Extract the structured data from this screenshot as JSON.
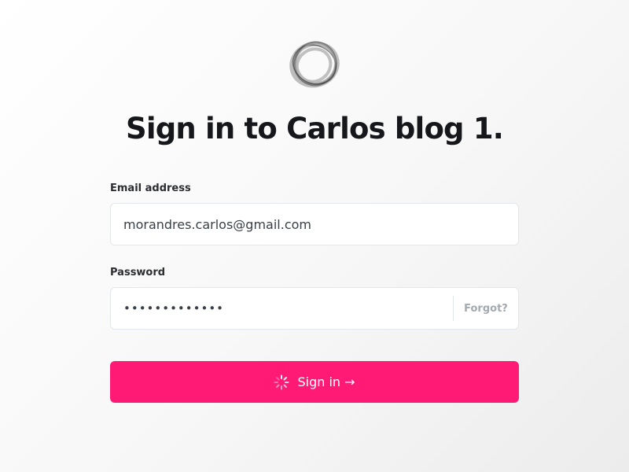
{
  "logo": {
    "icon": "ring-logo-icon"
  },
  "title": "Sign in to Carlos blog 1.",
  "form": {
    "email": {
      "label": "Email address",
      "value": "morandres.carlos@gmail.com"
    },
    "password": {
      "label": "Password",
      "masked_value": "•••••••••••••",
      "forgot_label": "Forgot?"
    },
    "submit": {
      "label": "Sign in →",
      "icon": "loading-spinner-icon",
      "color": "#ff1a75"
    }
  }
}
